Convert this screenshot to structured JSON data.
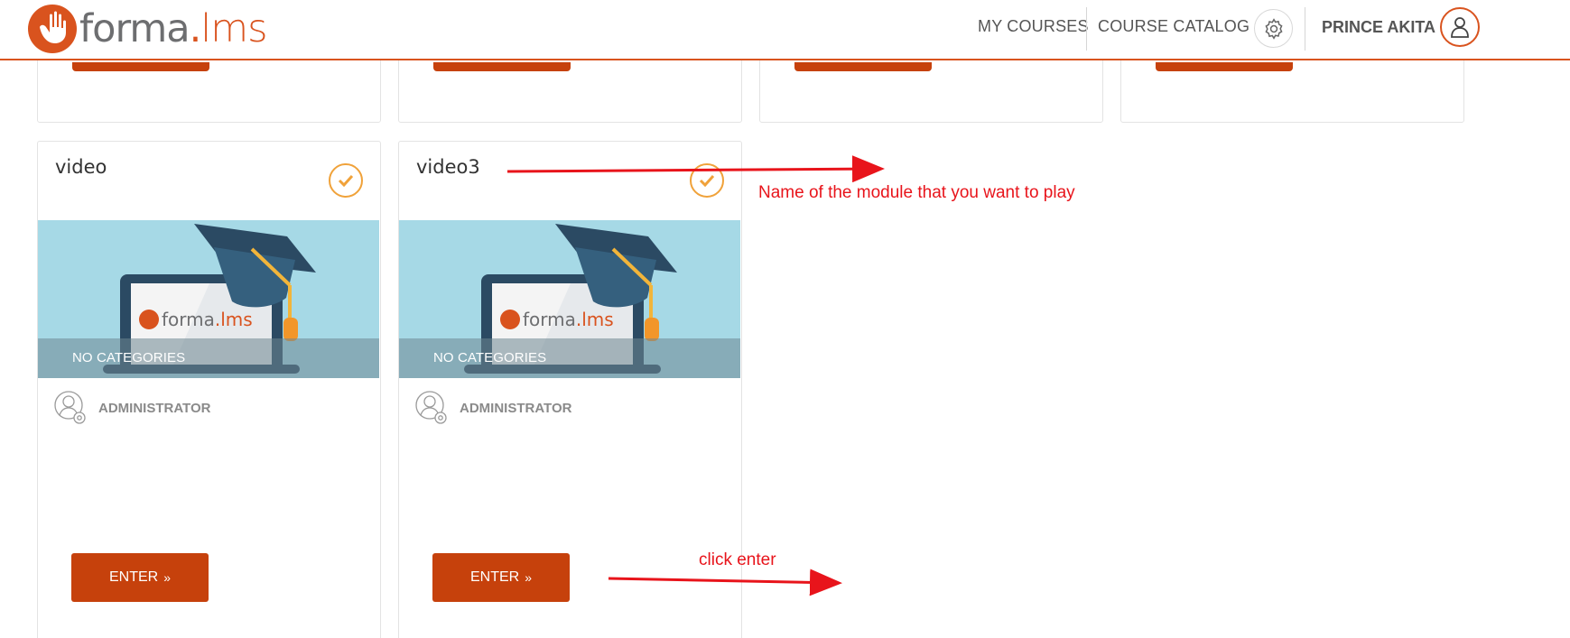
{
  "header": {
    "logo_word": "forma",
    "logo_dot": ".",
    "logo_suffix": "lms",
    "nav": {
      "my_courses": "MY COURSES",
      "course_catalog": "COURSE CATALOG"
    },
    "user_name": "PRINCE AKITA",
    "settings_icon": "gear-icon",
    "avatar_icon": "user-icon"
  },
  "courses": [
    {
      "title": "video",
      "category": "NO CATEGORIES",
      "teacher": "ADMINISTRATOR",
      "enter_label": "ENTER",
      "enter_icon": "»"
    },
    {
      "title": "video3",
      "category": "NO CATEGORIES",
      "teacher": "ADMINISTRATOR",
      "enter_label": "ENTER",
      "enter_icon": "»"
    }
  ],
  "thumbnail_brand": {
    "word": "forma",
    "dot": ".",
    "suffix": "lms"
  },
  "annotations": {
    "module_name": "Name of the module that you want to play",
    "click_enter": "click enter"
  },
  "colors": {
    "brand": "#d9531e",
    "button": "#c6410c",
    "check": "#f0a23a",
    "annotation": "#e8141b",
    "thumbnail_bg": "#a6d9e6"
  }
}
